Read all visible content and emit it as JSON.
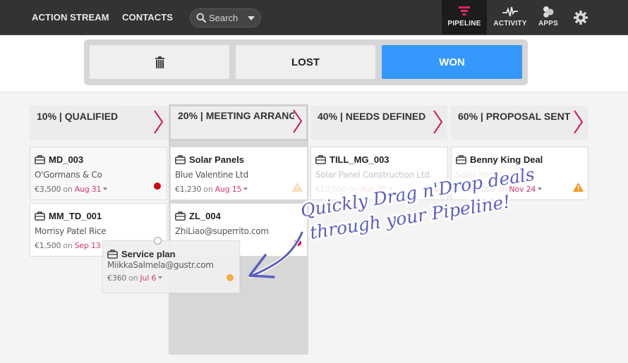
{
  "topnav": {
    "links": [
      {
        "label": "ACTION STREAM"
      },
      {
        "label": "CONTACTS"
      }
    ],
    "search": {
      "placeholder": "Search",
      "icon": "search-icon"
    },
    "icon_buttons": [
      {
        "label": "PIPELINE",
        "icon": "funnel-icon",
        "active": true,
        "icon_color": "#e8245a"
      },
      {
        "label": "ACTIVITY",
        "icon": "pulse-icon",
        "active": false
      },
      {
        "label": "APPS",
        "icon": "apps-icon",
        "active": false
      }
    ],
    "settings_icon": "gear-icon"
  },
  "drop_zones": {
    "trash": {
      "icon": "trash-icon"
    },
    "lost": {
      "label": "LOST"
    },
    "won": {
      "label": "WON",
      "color": "#3598fc"
    }
  },
  "stages": [
    {
      "percent": "10%",
      "name": "QUALIFIED",
      "title": "10% | QUALIFIED"
    },
    {
      "percent": "20%",
      "name": "MEETING ARRANGED",
      "title": "20% | MEETING ARRANG",
      "highlighted": true
    },
    {
      "percent": "40%",
      "name": "NEEDS DEFINED",
      "title": "40% | NEEDS DEFINED"
    },
    {
      "percent": "60%",
      "name": "PROPOSAL SENT",
      "title": "60% | PROPOSAL SENT"
    }
  ],
  "chevron_color": "#d01c4f",
  "deals": {
    "qualified": [
      {
        "title": "MD_003",
        "subtitle": "O'Gormans & Co",
        "amount": "€3,500",
        "on": "on",
        "date": "Aug 31",
        "status": "red-dot"
      },
      {
        "title": "MM_TD_001",
        "subtitle": "Morrisy Patel Rice",
        "amount": "€1,500",
        "on": "on",
        "date": "Sep 13",
        "status": "none"
      }
    ],
    "meeting": [
      {
        "title": "Solar Panels",
        "subtitle": "Blue Valentine Ltd",
        "amount": "€1,230",
        "on": "on",
        "date": "Aug 15",
        "status": "warning"
      },
      {
        "title": "ZL_004",
        "subtitle": "ZhiLiao@superrito.com",
        "amount": "",
        "on": "",
        "date": "",
        "status": "red-dot"
      }
    ],
    "needs_defined": [
      {
        "title": "TILL_MG_003",
        "subtitle": "Solar Panel Construction Ltd.",
        "amount": "€10,000",
        "on": "on",
        "date": "Aug 30",
        "status": "warning"
      }
    ],
    "proposal_sent": [
      {
        "title": "Benny King Deal",
        "subtitle": "Solar Holdings",
        "amount": "€25,000",
        "on": "on",
        "date": "Nov 24",
        "status": "warning"
      }
    ]
  },
  "dragging_card": {
    "title": "Service plan",
    "subtitle": "MiikkaSalmela@gustr.com",
    "amount": "€360",
    "on": "on",
    "date": "Jul 6",
    "status": "orange-dot"
  },
  "status_colors": {
    "red": "#d40012",
    "orange": "#f9a93a",
    "warning": "#f7941d"
  },
  "annotation": {
    "line1": "Quickly Drag n'Drop deals",
    "line2": "through your Pipeline!",
    "color": "#5b5fc0"
  }
}
